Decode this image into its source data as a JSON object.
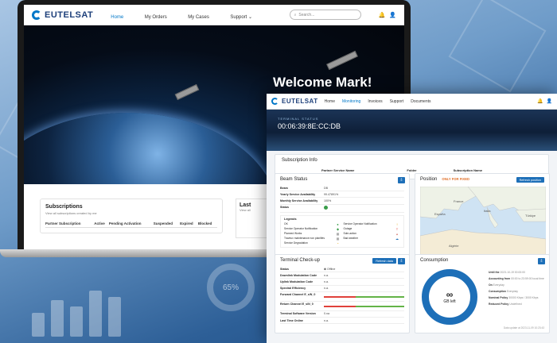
{
  "laptop": {
    "brand": "EUTELSAT",
    "nav": [
      "Home",
      "My Orders",
      "My Cases",
      "Support"
    ],
    "search_placeholder": "Search...",
    "welcome": "Welcome Mark!",
    "subscriptions": {
      "title": "Subscriptions",
      "description": "View all subscriptions created by me",
      "columns": [
        "Partner Subscription",
        "Active",
        "Pending Activation",
        "Suspended",
        "Expired",
        "Blocked"
      ]
    },
    "last_title": "Last",
    "last_desc": "View all"
  },
  "detail": {
    "brand": "EUTELSAT",
    "nav": [
      "Home",
      "Monitoring",
      "Invoices",
      "Support",
      "Documents"
    ],
    "terminal_status_label": "TERMINAL STATUS",
    "terminal_mac": "00:06:39:8E:CC:DB",
    "subscription_info": {
      "title": "Subscription Info",
      "partner_service_name_label": "Partner Service Name",
      "folder_label": "Folder",
      "subscription_name_label": "Subscription Name"
    },
    "beam_status": {
      "title": "Beam Status",
      "rows": [
        {
          "k": "Beam",
          "v": "DB"
        },
        {
          "k": "Yearly Service Availability",
          "v": "99.47891%"
        },
        {
          "k": "Monthly Service Availability",
          "v": "100%"
        },
        {
          "k": "Status",
          "v": ""
        }
      ],
      "legends_title": "Legends",
      "legends": [
        {
          "a": "OK",
          "b": "Service Operator Notification"
        },
        {
          "a": "Service Operator Notification",
          "b": "Outage"
        },
        {
          "a": "Planned Works",
          "b": "Sole-action"
        },
        {
          "a": "Traveux maintenance non planifiés",
          "b": "Bad weather"
        },
        {
          "a": "Service Degradation",
          "b": ""
        }
      ]
    },
    "position": {
      "title": "Position",
      "only_fixed": "ONLY FOR FIXED",
      "refresh": "Refresh position",
      "labels": [
        "France",
        "Italia",
        "España",
        "Türkiye",
        "Algérie"
      ]
    },
    "terminal_checkup": {
      "title": "Terminal Check-up",
      "refresh": "Refresh data",
      "rows": [
        {
          "k": "Status",
          "v": "Offline"
        },
        {
          "k": "Downlink Modulation Code",
          "v": "n.a."
        },
        {
          "k": "Uplink Modulation Code",
          "v": "n.a."
        },
        {
          "k": "Spectral Efficiency",
          "v": "n.a."
        },
        {
          "k": "Forward Channel E_s/N_0",
          "v": ""
        },
        {
          "k": "Return Channel E_s/N_0",
          "v": ""
        },
        {
          "k": "Terminal Software Version",
          "v": "0.na"
        },
        {
          "k": "Last Time Online",
          "v": "n.a."
        }
      ]
    },
    "consumption": {
      "title": "Consumption",
      "infinity": "∞",
      "gb_left": "GB left",
      "details": [
        {
          "k": "Until the",
          "v": "2023-10-19 00:00:00"
        },
        {
          "k": "Accounting from",
          "v": "00:00 to 23:59:00 local time"
        },
        {
          "k": "On",
          "v": "Everyday"
        },
        {
          "k": "Consumption",
          "v": "Everyday"
        },
        {
          "k": "Nominal Policy",
          "v": "30000 Kbps / 3000 Kbps"
        },
        {
          "k": "Reduced Policy",
          "v": "Undefined"
        }
      ],
      "update_note": "Data update at 2023-11-09 10:23:43"
    }
  }
}
